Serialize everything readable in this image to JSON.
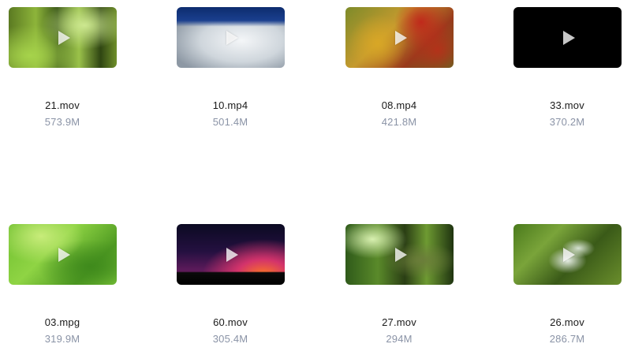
{
  "videos": [
    {
      "name": "21.mov",
      "size": "573.9M",
      "thumb": "forest-canopy"
    },
    {
      "name": "10.mp4",
      "size": "501.4M",
      "thumb": "icy-rocks"
    },
    {
      "name": "08.mp4",
      "size": "421.8M",
      "thumb": "autumn-leaves"
    },
    {
      "name": "33.mov",
      "size": "370.2M",
      "thumb": "black-frame"
    },
    {
      "name": "03.mpg",
      "size": "319.9M",
      "thumb": "green-leaves"
    },
    {
      "name": "60.mov",
      "size": "305.4M",
      "thumb": "sunset-silhouette"
    },
    {
      "name": "27.mov",
      "size": "294M",
      "thumb": "jungle-trees"
    },
    {
      "name": "26.mov",
      "size": "286.7M",
      "thumb": "mossy-stream"
    }
  ],
  "icons": {
    "play": "play-icon"
  },
  "colors": {
    "filename": "#1a1a1a",
    "filesize": "#8a93a6",
    "play_overlay": "#ffffff"
  }
}
